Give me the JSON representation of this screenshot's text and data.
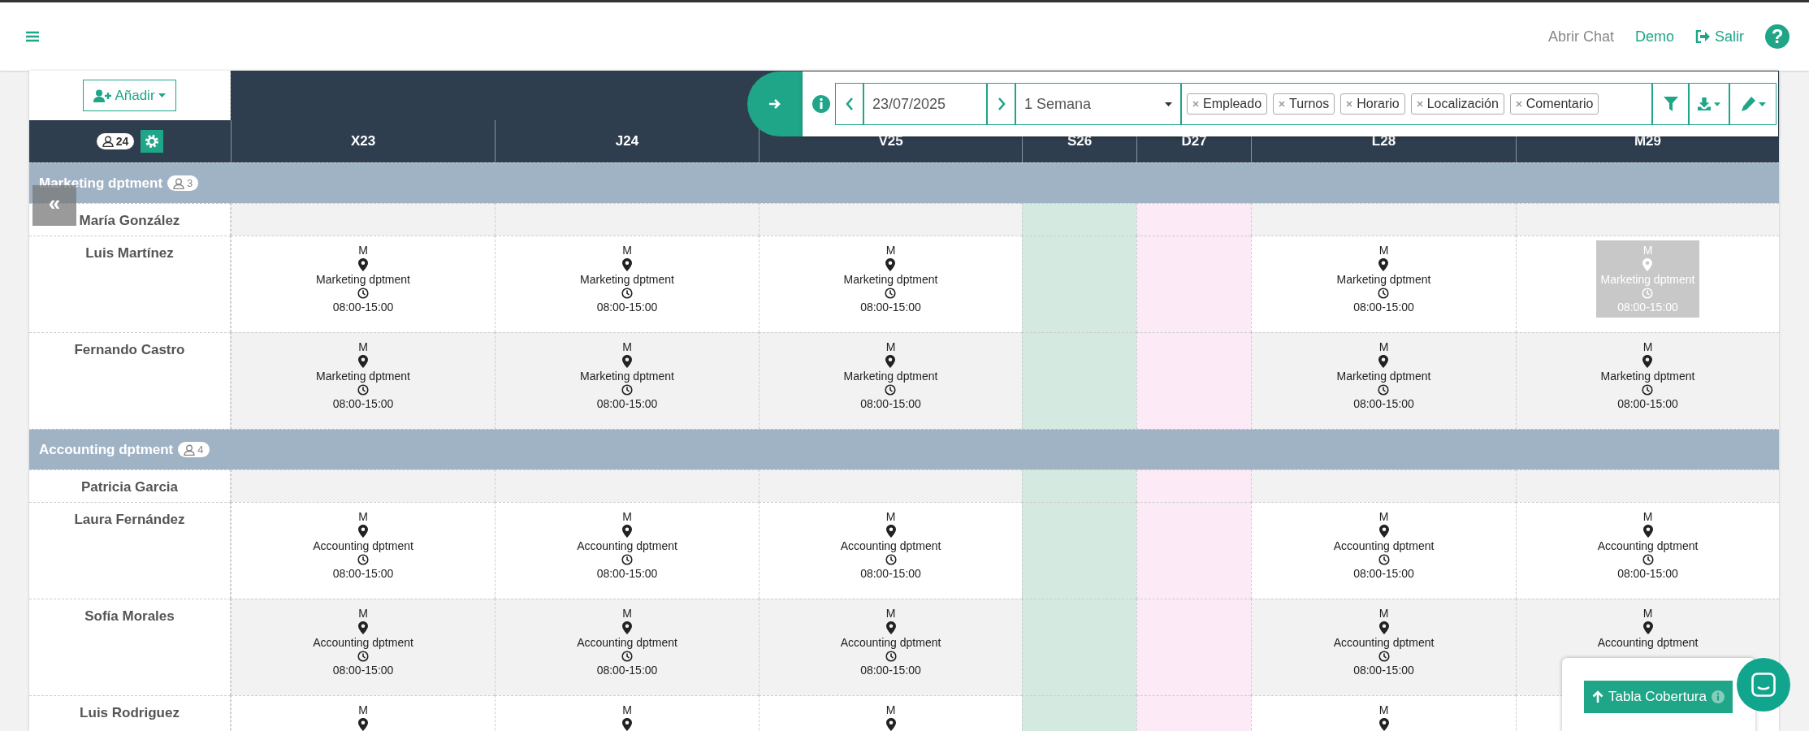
{
  "topbar": {
    "links": [
      {
        "label": "Abrir Chat",
        "kind": "muted"
      },
      {
        "label": "Demo",
        "kind": "accent"
      },
      {
        "label": "Salir",
        "kind": "exit"
      }
    ],
    "help": "?"
  },
  "add_button": {
    "label": "Añadir"
  },
  "employee_count": "24",
  "days": [
    {
      "label": "X23",
      "kind": "weekday"
    },
    {
      "label": "J24",
      "kind": "weekday"
    },
    {
      "label": "V25",
      "kind": "weekday"
    },
    {
      "label": "S26",
      "kind": "saturday"
    },
    {
      "label": "D27",
      "kind": "sunday"
    },
    {
      "label": "L28",
      "kind": "weekday"
    },
    {
      "label": "M29",
      "kind": "weekday"
    }
  ],
  "toolbar": {
    "date": "23/07/2025",
    "period": "1 Semana",
    "tags": [
      "Empleado",
      "Turnos",
      "Horario",
      "Localización",
      "Comentario"
    ]
  },
  "collapse": "«",
  "groups": [
    {
      "name": "Marketing dptment",
      "count": "3",
      "rows": [
        {
          "name": "María González",
          "cells": [
            null,
            null,
            null,
            null,
            null,
            null,
            null
          ]
        },
        {
          "name": "Luis Martínez",
          "cells": [
            {
              "code": "M",
              "location": "Marketing dptment",
              "time": "08:00-15:00",
              "selected": false
            },
            {
              "code": "M",
              "location": "Marketing dptment",
              "time": "08:00-15:00",
              "selected": false
            },
            {
              "code": "M",
              "location": "Marketing dptment",
              "time": "08:00-15:00",
              "selected": false
            },
            null,
            null,
            {
              "code": "M",
              "location": "Marketing dptment",
              "time": "08:00-15:00",
              "selected": false
            },
            {
              "code": "M",
              "location": "Marketing dptment",
              "time": "08:00-15:00",
              "selected": true
            }
          ]
        },
        {
          "name": "Fernando Castro",
          "cells": [
            {
              "code": "M",
              "location": "Marketing dptment",
              "time": "08:00-15:00",
              "selected": false
            },
            {
              "code": "M",
              "location": "Marketing dptment",
              "time": "08:00-15:00",
              "selected": false
            },
            {
              "code": "M",
              "location": "Marketing dptment",
              "time": "08:00-15:00",
              "selected": false
            },
            null,
            null,
            {
              "code": "M",
              "location": "Marketing dptment",
              "time": "08:00-15:00",
              "selected": false
            },
            {
              "code": "M",
              "location": "Marketing dptment",
              "time": "08:00-15:00",
              "selected": false
            }
          ]
        }
      ]
    },
    {
      "name": "Accounting dptment",
      "count": "4",
      "rows": [
        {
          "name": "Patricia Garcia",
          "cells": [
            null,
            null,
            null,
            null,
            null,
            null,
            null
          ]
        },
        {
          "name": "Laura Fernández",
          "cells": [
            {
              "code": "M",
              "location": "Accounting dptment",
              "time": "08:00-15:00",
              "selected": false
            },
            {
              "code": "M",
              "location": "Accounting dptment",
              "time": "08:00-15:00",
              "selected": false
            },
            {
              "code": "M",
              "location": "Accounting dptment",
              "time": "08:00-15:00",
              "selected": false
            },
            null,
            null,
            {
              "code": "M",
              "location": "Accounting dptment",
              "time": "08:00-15:00",
              "selected": false
            },
            {
              "code": "M",
              "location": "Accounting dptment",
              "time": "08:00-15:00",
              "selected": false
            }
          ]
        },
        {
          "name": "Sofía Morales",
          "cells": [
            {
              "code": "M",
              "location": "Accounting dptment",
              "time": "08:00-15:00",
              "selected": false
            },
            {
              "code": "M",
              "location": "Accounting dptment",
              "time": "08:00-15:00",
              "selected": false
            },
            {
              "code": "M",
              "location": "Accounting dptment",
              "time": "08:00-15:00",
              "selected": false
            },
            null,
            null,
            {
              "code": "M",
              "location": "Accounting dptment",
              "time": "08:00-15:00",
              "selected": false
            },
            {
              "code": "M",
              "location": "Accounting dptment",
              "selected": false
            }
          ]
        },
        {
          "name": "Luis Rodriguez",
          "cells": [
            {
              "code": "M",
              "selected": false
            },
            {
              "code": "M",
              "selected": false
            },
            {
              "code": "M",
              "selected": false
            },
            null,
            null,
            {
              "code": "M",
              "selected": false
            },
            null
          ]
        }
      ]
    }
  ],
  "coverage": {
    "label": "Tabla Cobertura"
  }
}
